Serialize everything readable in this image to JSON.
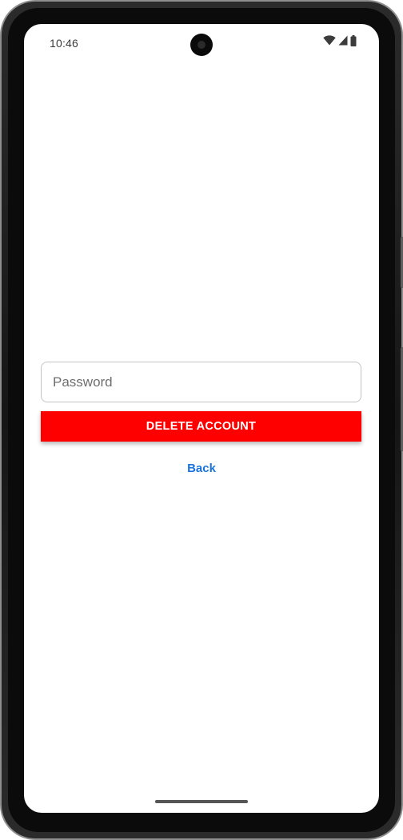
{
  "status_bar": {
    "time": "10:46",
    "icons": [
      "wifi-icon",
      "cellular-signal-icon",
      "battery-icon"
    ]
  },
  "form": {
    "password_placeholder": "Password",
    "password_value": "",
    "delete_label": "DELETE ACCOUNT",
    "back_label": "Back"
  },
  "colors": {
    "delete_button": "#ff0000",
    "back_link": "#1a73d9",
    "field_border": "#c4c4c4"
  }
}
